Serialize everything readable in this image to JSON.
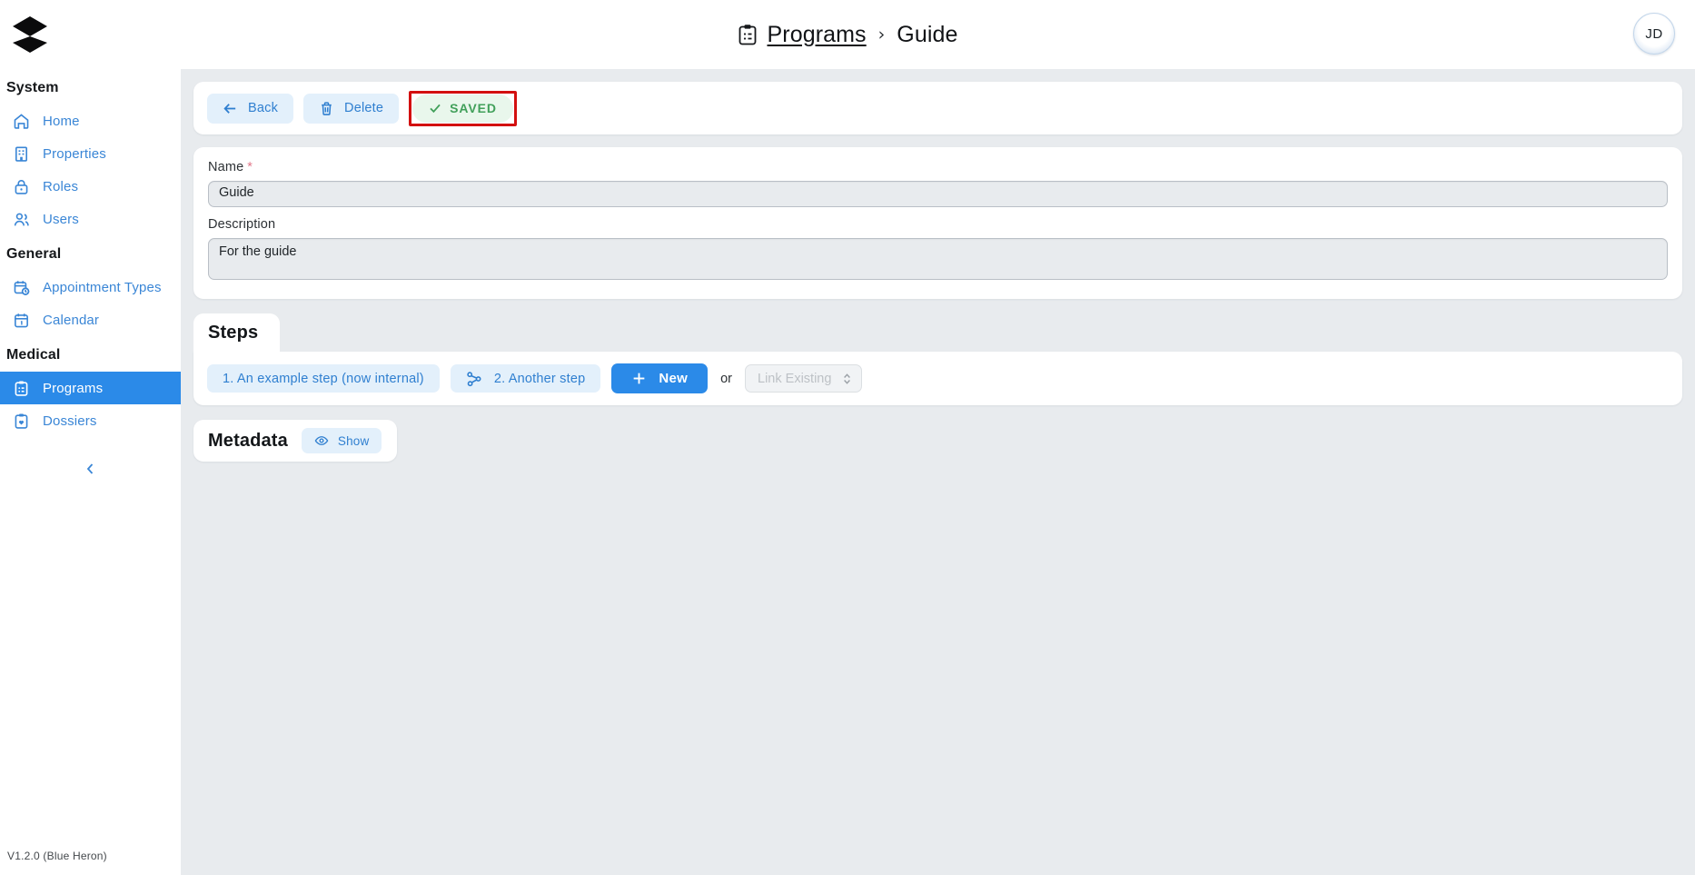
{
  "app": {
    "logo_name": "app-logo",
    "version": "V1.2.0 (Blue Heron)"
  },
  "header": {
    "breadcrumb": {
      "icon": "clipboard-list-icon",
      "parent": "Programs",
      "separator": "›",
      "current": "Guide"
    },
    "avatar_initials": "JD"
  },
  "sidebar": {
    "collapse_icon": "chevron-left-icon",
    "groups": [
      {
        "title": "System",
        "items": [
          {
            "label": "Home",
            "icon": "home-icon",
            "active": false
          },
          {
            "label": "Properties",
            "icon": "building-icon",
            "active": false
          },
          {
            "label": "Roles",
            "icon": "lock-icon",
            "active": false
          },
          {
            "label": "Users",
            "icon": "users-icon",
            "active": false
          }
        ]
      },
      {
        "title": "General",
        "items": [
          {
            "label": "Appointment Types",
            "icon": "calendar-clock-icon",
            "active": false
          },
          {
            "label": "Calendar",
            "icon": "calendar-icon",
            "active": false
          }
        ]
      },
      {
        "title": "Medical",
        "items": [
          {
            "label": "Programs",
            "icon": "clipboard-list-icon",
            "active": true
          },
          {
            "label": "Dossiers",
            "icon": "clipboard-heart-icon",
            "active": false
          }
        ]
      }
    ]
  },
  "toolbar": {
    "back_label": "Back",
    "back_icon": "arrow-left-icon",
    "delete_label": "Delete",
    "delete_icon": "trash-icon",
    "saved_label": "SAVED",
    "saved_icon": "check-icon",
    "saved_highlight_color": "#d31010",
    "saved_text_color": "#41a05a"
  },
  "form": {
    "name": {
      "label": "Name",
      "required_marker": "*",
      "value": "Guide",
      "placeholder": "Name"
    },
    "description": {
      "label": "Description",
      "value": "For the guide",
      "placeholder": "Description"
    }
  },
  "steps": {
    "tab_label": "Steps",
    "items": [
      {
        "label": "1. An example step (now internal)",
        "icon": ""
      },
      {
        "label": "2. Another step",
        "icon": "share-nodes-icon"
      }
    ],
    "new_label": "New",
    "new_icon": "plus-icon",
    "or_label": "or",
    "link_existing": {
      "selected": "Link Existing",
      "options": [
        "Link Existing"
      ],
      "caret_icon": "chevron-updown-icon",
      "disabled": true
    }
  },
  "metadata": {
    "title": "Metadata",
    "show_label": "Show",
    "show_icon": "eye-icon"
  },
  "colors": {
    "accent": "#2b8ae8",
    "link": "#3a86d6",
    "soft_blue_bg": "#e3f0fb",
    "page_bg": "#e8ebee",
    "success": "#41a05a",
    "highlight": "#d31010"
  }
}
